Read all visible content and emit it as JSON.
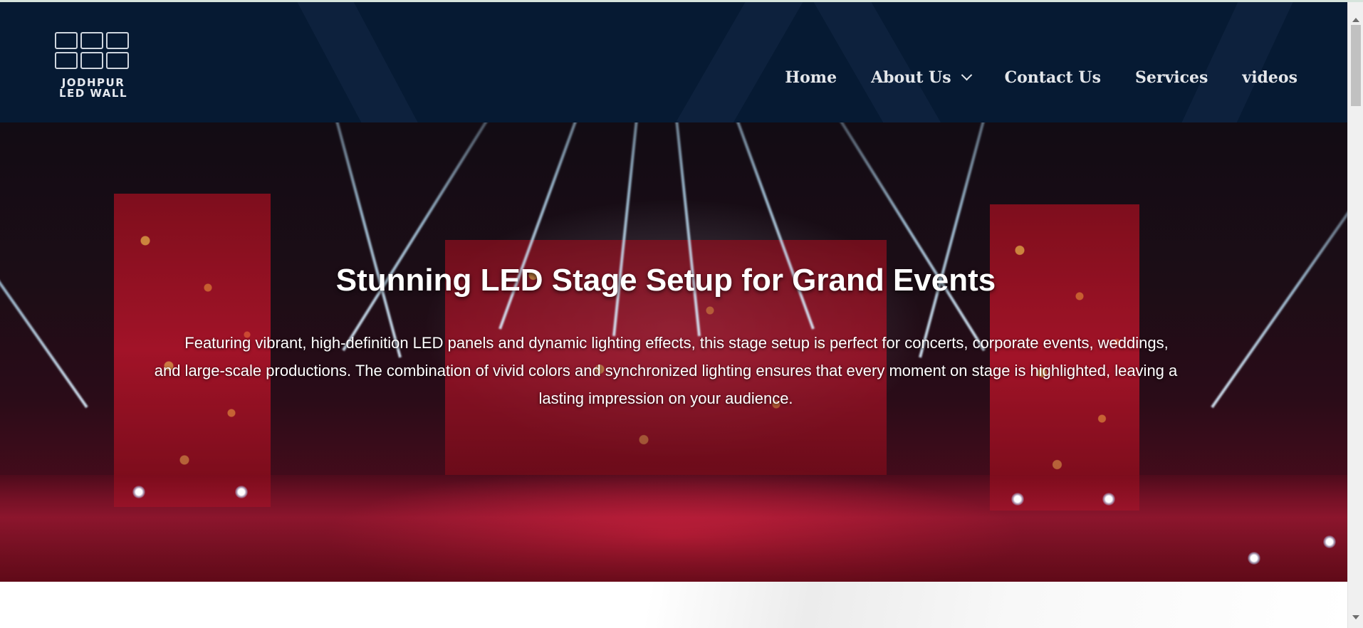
{
  "logo": {
    "line1": "JODHPUR",
    "line2": "LED WALL"
  },
  "nav": {
    "items": [
      {
        "label": "Home",
        "has_dropdown": false
      },
      {
        "label": "About Us",
        "has_dropdown": true
      },
      {
        "label": "Contact Us",
        "has_dropdown": false
      },
      {
        "label": "Services",
        "has_dropdown": false
      },
      {
        "label": "videos",
        "has_dropdown": false
      }
    ]
  },
  "hero": {
    "title": "Stunning LED Stage Setup for Grand Events",
    "description": "Featuring vibrant, high-definition LED panels and dynamic lighting effects, this stage setup is perfect for concerts, corporate events, weddings, and large-scale productions. The combination of vivid colors and synchronized lighting ensures that every moment on stage is highlighted, leaving a lasting impression on your audience."
  },
  "colors": {
    "header_bg": "#061a33",
    "nav_text": "#e3e6ea",
    "hero_text": "#ffffff"
  },
  "icons": {
    "logo": "led-wall-grid-icon",
    "dropdown": "chevron-down-icon"
  }
}
